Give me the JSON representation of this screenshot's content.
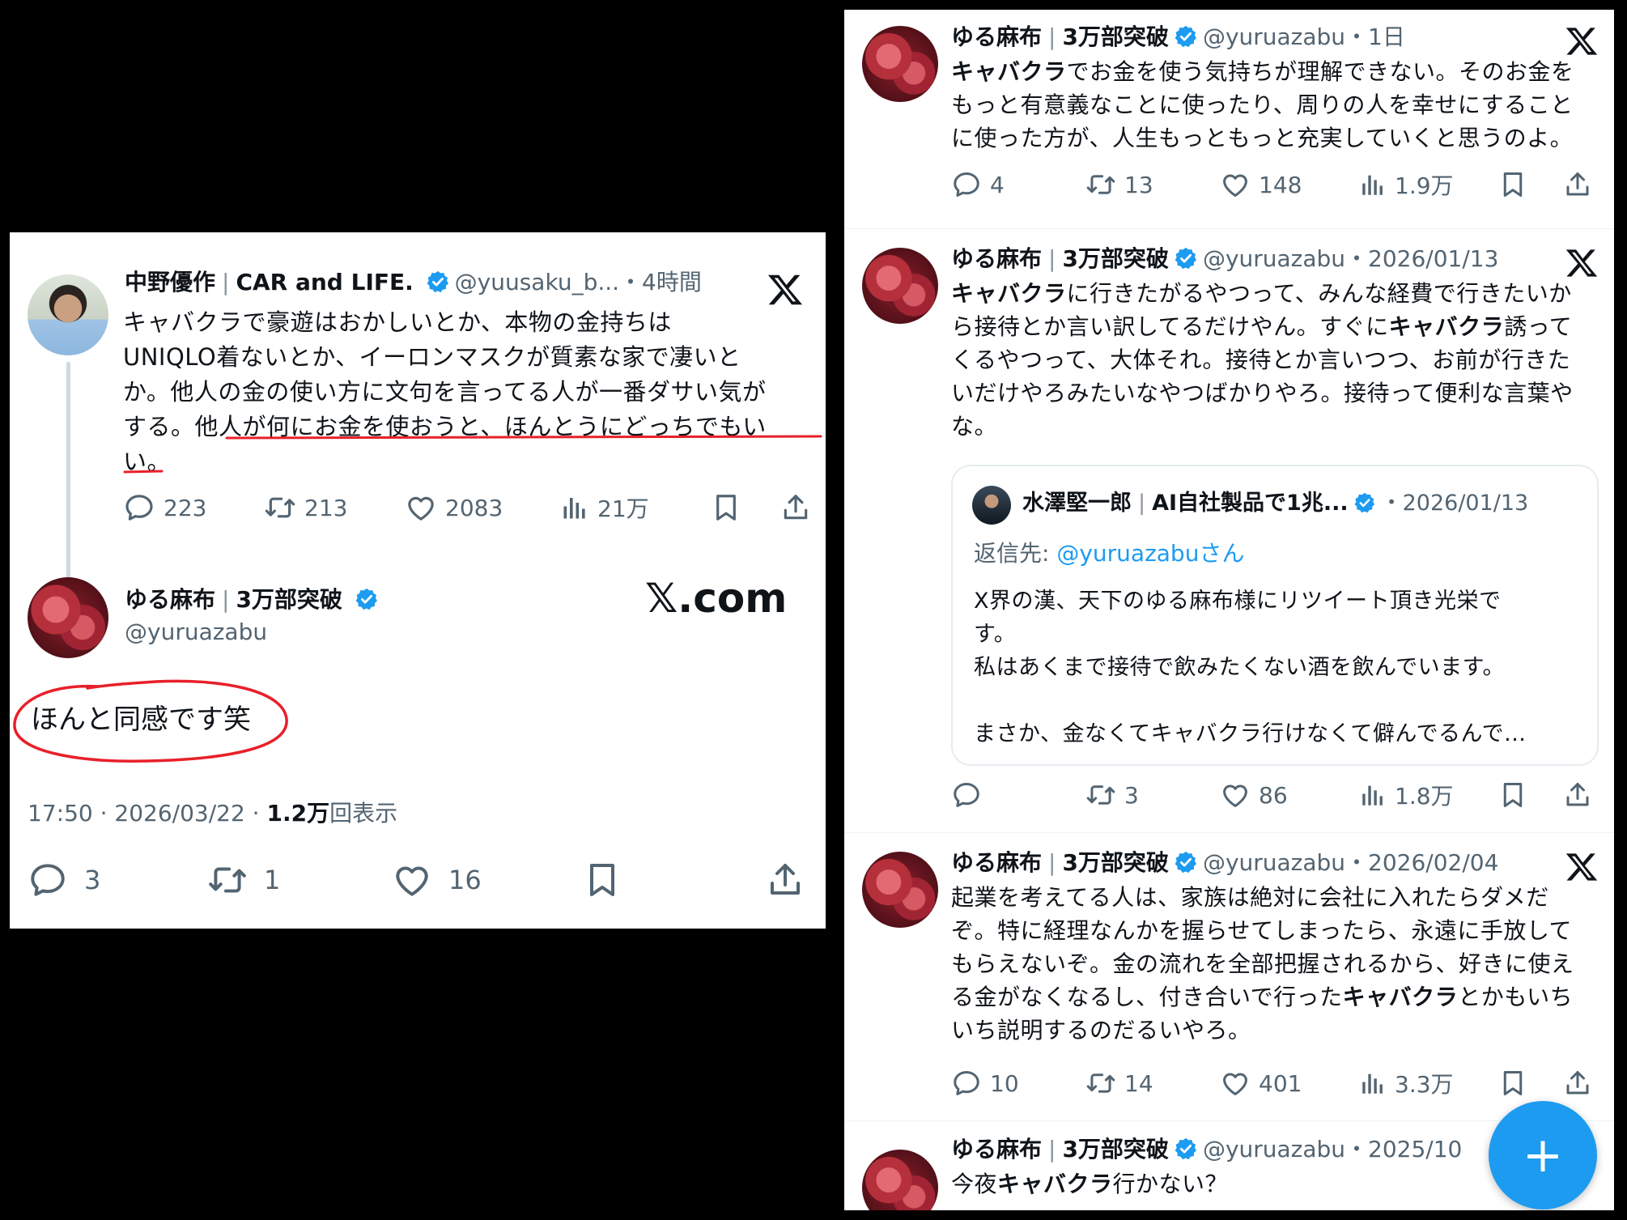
{
  "left_thread": {
    "tweet1": {
      "display_name": "中野優作",
      "display_name_suffix": "CAR and LIFE.",
      "handle": "@yuusaku_b...",
      "time": "・4時間",
      "text_lines": [
        "キャバクラで豪遊はおかしいとか、本物の金持ちは",
        "UNIQLO着ないとか、イーロンマスクが質素な家で凄いと",
        "か。他人の金の使い方に文句を言ってる人が一番ダサい気が",
        "する。他人が何にお金を使おうと、ほんとうにどっちでもい",
        "い。"
      ],
      "replies": "223",
      "reposts": "213",
      "likes": "2083",
      "views": "21万"
    },
    "tweet2": {
      "display_name": "ゆる麻布",
      "display_name_suffix": "3万部突破",
      "handle": "@yuruazabu",
      "site_label": "𝕏.com",
      "text": "ほんと同感です笑",
      "timestamp": "17:50 · 2026/03/22 · ",
      "view_count": "1.2万",
      "view_label": "回表示",
      "replies": "3",
      "reposts": "1",
      "likes": "16"
    }
  },
  "right_feed": {
    "posts": [
      {
        "display_name": "ゆる麻布",
        "display_name_suffix": "3万部突破",
        "handle": "@yuruazabu",
        "time": "・1日",
        "text_html": [
          "<b>キャバクラ</b>でお金を使う気持ちが理解できない。そのお金を",
          "もっと有意義なことに使ったり、周りの人を幸せにすること",
          "に使った方が、人生もっともっと充実していくと思うのよ。"
        ],
        "replies": "4",
        "reposts": "13",
        "likes": "148",
        "views": "1.9万"
      },
      {
        "display_name": "ゆる麻布",
        "display_name_suffix": "3万部突破",
        "handle": "@yuruazabu",
        "time": "・2026/01/13",
        "text_html": [
          "<b>キャバクラ</b>に行きたがるやつって、みんな経費で行きたいか",
          "ら接待とか言い訳してるだけやん。すぐに<b>キャバクラ</b>誘って",
          "くるやつって、大体それ。接待とか言いつつ、お前が行きた",
          "いだけやろみたいなやつばかりやろ。接待って便利な言葉や",
          "な。"
        ],
        "quote": {
          "display_name": "水澤堅一郎",
          "display_name_suffix": "AI自社製品で1兆...",
          "time": "・2026/01/13",
          "reply_to_prefix": "返信先: ",
          "reply_to_handle": "@yuruazabuさん",
          "text_lines": [
            "X界の漢、天下のゆる麻布様にリツイート頂き光栄で",
            "す。",
            "私はあくまで接待で飲みたくない酒を飲んでいます。",
            "",
            "まさか、金なくてキャバクラ行けなくて僻んでるんで..."
          ]
        },
        "replies": "",
        "reposts": "3",
        "likes": "86",
        "views": "1.8万"
      },
      {
        "display_name": "ゆる麻布",
        "display_name_suffix": "3万部突破",
        "handle": "@yuruazabu",
        "time": "・2026/02/04",
        "text_html": [
          "起業を考えてる人は、家族は絶対に会社に入れたらダメだ",
          "ぞ。特に経理なんかを握らせてしまったら、永遠に手放して",
          "もらえないぞ。金の流れを全部把握されるから、好きに使え",
          "る金がなくなるし、付き合いで行った<b>キャバクラ</b>とかもいち",
          "いち説明するのだるいやろ。"
        ],
        "replies": "10",
        "reposts": "14",
        "likes": "401",
        "views": "3.3万"
      },
      {
        "display_name": "ゆる麻布",
        "display_name_suffix": "3万部突破",
        "handle": "@yuruazabu",
        "time": "・2025/10",
        "text_html": [
          "今夜<b>キャバクラ</b>行かない？"
        ]
      }
    ],
    "fab_label": "+"
  },
  "colors": {
    "verified_blue": "#1d9bf0",
    "annotation_red": "#e8202a",
    "muted_text": "#536471",
    "background": "#000000"
  }
}
